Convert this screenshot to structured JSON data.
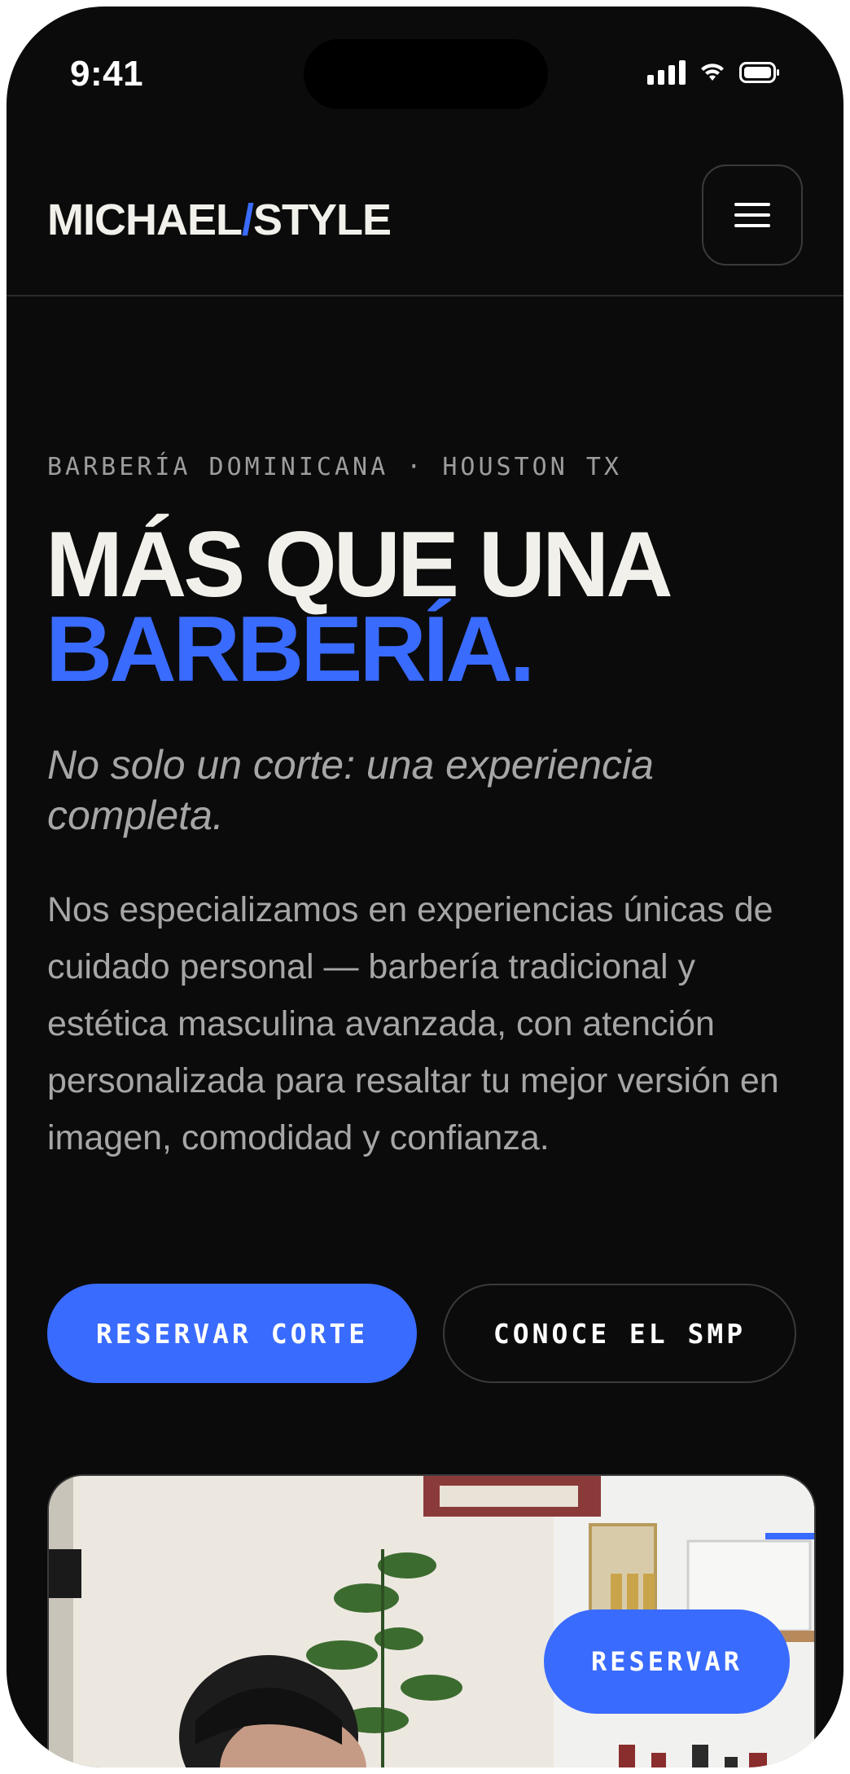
{
  "status_bar": {
    "time": "9:41"
  },
  "header": {
    "logo_left": "MICHAEL",
    "logo_slash": "/",
    "logo_right": "STYLE"
  },
  "hero": {
    "eyebrow": "BARBERÍA DOMINICANA · HOUSTON TX",
    "headline_line1": "MÁS QUE UNA",
    "headline_line2": "BARBERÍA.",
    "subtitle": "No solo un corte: una experiencia completa.",
    "description": "Nos especializamos en experiencias únicas de cuidado personal — barbería tradicional y estética masculina avanzada, con atención personalizada para resaltar tu mejor versión en imagen, comodidad y confianza.",
    "primary_button": "RESERVAR CORTE",
    "secondary_button": "CONOCE EL SMP"
  },
  "fab": {
    "label": "RESERVAR"
  },
  "colors": {
    "background": "#0b0b0b",
    "accent": "#3a6bff",
    "headline_text": "#f2f0ea",
    "muted_text": "#a6a6a6"
  }
}
